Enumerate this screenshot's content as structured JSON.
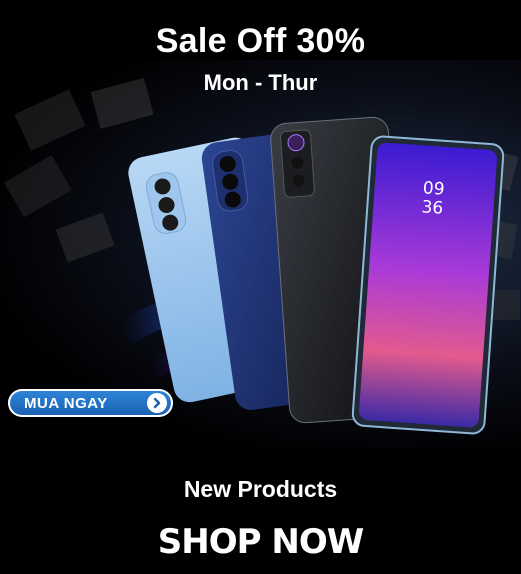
{
  "banner": {
    "headline": "Sale Off 30%",
    "subheadline": "Mon - Thur",
    "cta_label": "MUA NGAY",
    "cta_icon": "chevron-right-icon",
    "new_products_label": "New Products",
    "shop_now_label": "SHOP NOW"
  },
  "phone_screen": {
    "clock": "09\n36",
    "clock_hour": "09",
    "clock_minute": "36"
  },
  "colors": {
    "background": "#000000",
    "text": "#ffffff",
    "cta_blue": "#1a6fc7",
    "swoosh_red": "#e0203a",
    "swoosh_blue": "#2a6ff0",
    "screen_purple": "#8a2bd8"
  }
}
